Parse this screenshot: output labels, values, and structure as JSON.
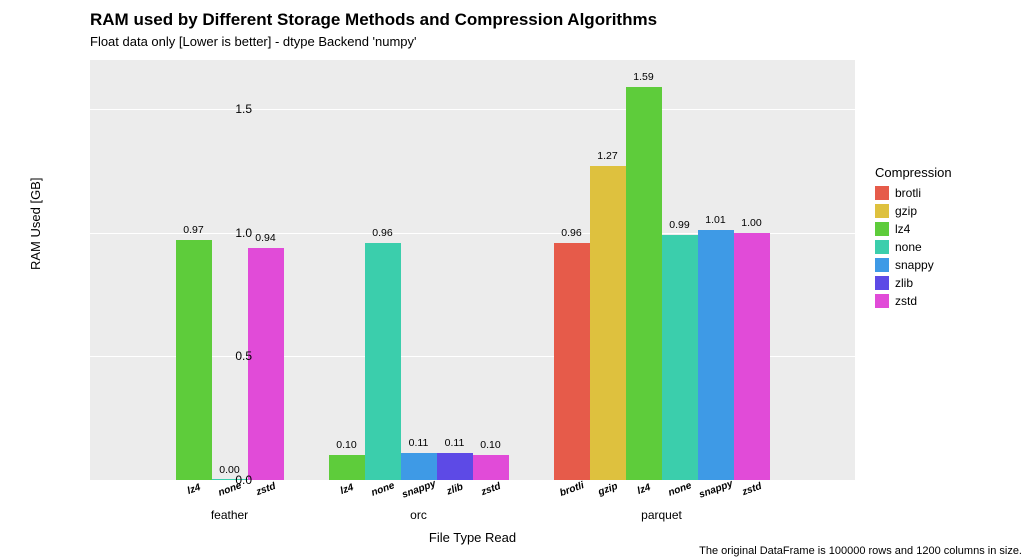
{
  "chart_data": {
    "type": "bar",
    "title": "RAM used by Different Storage Methods and Compression Algorithms",
    "subtitle": "Float data only [Lower is better] - dtype Backend 'numpy'",
    "xlabel": "File Type Read",
    "ylabel": "RAM Used [GB]",
    "caption": "The original DataFrame is 100000 rows and 1200 columns in size.",
    "ylim": [
      0,
      1.7
    ],
    "yticks": [
      0.0,
      0.5,
      1.0,
      1.5
    ],
    "legend_title": "Compression",
    "groups": [
      "feather",
      "orc",
      "parquet"
    ],
    "series_order": [
      "brotli",
      "gzip",
      "lz4",
      "none",
      "snappy",
      "zlib",
      "zstd"
    ],
    "colors": {
      "brotli": "#e65b4a",
      "gzip": "#dec13e",
      "lz4": "#5ecc3b",
      "none": "#3bceac",
      "snappy": "#3e9ae6",
      "zlib": "#5d4ae6",
      "zstd": "#e14bd8"
    },
    "data": {
      "feather": {
        "lz4": 0.97,
        "none": 0.0,
        "zstd": 0.94
      },
      "orc": {
        "lz4": 0.1,
        "none": 0.96,
        "snappy": 0.11,
        "zlib": 0.11,
        "zstd": 0.1
      },
      "parquet": {
        "brotli": 0.96,
        "gzip": 1.27,
        "lz4": 1.59,
        "none": 0.99,
        "snappy": 1.01,
        "zstd": 1.0
      }
    }
  }
}
